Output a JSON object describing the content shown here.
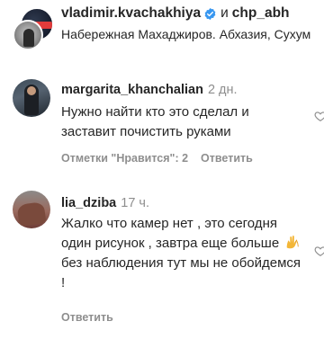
{
  "post": {
    "author1": "vladimir.kvachakhiya",
    "conjunction": "и",
    "author2": "chp_abh",
    "location": "Набережная Махаджиров. Абхазия, Сухум",
    "verified_icon": "verified-badge-icon"
  },
  "comments": [
    {
      "username": "margarita_khanchalian",
      "time": "2 дн.",
      "text": "Нужно найти кто это сделал и заставит почистить руками",
      "likes_label": "Отметки \"Нравится\": 2",
      "reply_label": "Ответить"
    },
    {
      "username": "lia_dziba",
      "time": "17 ч.",
      "text_before_emoji": "Жалко что камер нет , это сегодня один рисунок , завтра еще больше ",
      "emoji": "🙌",
      "text_after_emoji": " без наблюдения тут мы не обойдемся !",
      "reply_label": "Ответить"
    }
  ],
  "colors": {
    "text": "#262626",
    "muted": "#8e8e8e",
    "verified": "#3897f0"
  }
}
